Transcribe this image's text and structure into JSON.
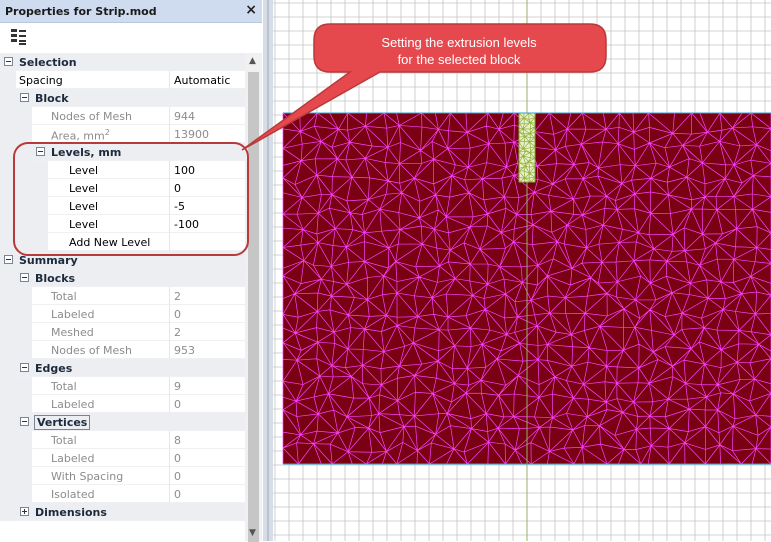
{
  "panel": {
    "title": "Properties for Strip.mod",
    "close_glyph": "×",
    "toolbar_icon": "categorized-view-icon"
  },
  "rows": {
    "selection": "Selection",
    "spacing_label": "Spacing",
    "spacing_value": "Automatic",
    "block": "Block",
    "block_nodes_label": "Nodes of Mesh",
    "block_nodes_value": "944",
    "block_area_label": "Area, mm",
    "block_area_sup": "2",
    "block_area_value": "13900",
    "levels": "Levels, mm",
    "levels_items": [
      {
        "label": "Level",
        "value": "100"
      },
      {
        "label": "Level",
        "value": "0"
      },
      {
        "label": "Level",
        "value": "-5"
      },
      {
        "label": "Level",
        "value": "-100"
      }
    ],
    "add_level": "Add New Level",
    "summary": "Summary",
    "blocks": "Blocks",
    "blocks_total_label": "Total",
    "blocks_total_value": "2",
    "blocks_labeled_label": "Labeled",
    "blocks_labeled_value": "0",
    "blocks_meshed_label": "Meshed",
    "blocks_meshed_value": "2",
    "blocks_nodes_label": "Nodes of Mesh",
    "blocks_nodes_value": "953",
    "edges": "Edges",
    "edges_total_label": "Total",
    "edges_total_value": "9",
    "edges_labeled_label": "Labeled",
    "edges_labeled_value": "0",
    "vertices": "Vertices",
    "vertices_total_label": "Total",
    "vertices_total_value": "8",
    "vertices_labeled_label": "Labeled",
    "vertices_labeled_value": "0",
    "vertices_spacing_label": "With Spacing",
    "vertices_spacing_value": "0",
    "vertices_isolated_label": "Isolated",
    "vertices_isolated_value": "0",
    "dimensions": "Dimensions"
  },
  "callout": {
    "line1": "Setting the extrusion levels",
    "line2": "for the selected block"
  },
  "colors": {
    "block_fill": "#7a0014",
    "mesh": "#ff40ff",
    "grid": "#c4c4c4",
    "axis": "#9ab06a",
    "callout_fill": "#e5484d",
    "highlight_border": "#b83a3a",
    "selected_block": "#e8f0c8"
  }
}
